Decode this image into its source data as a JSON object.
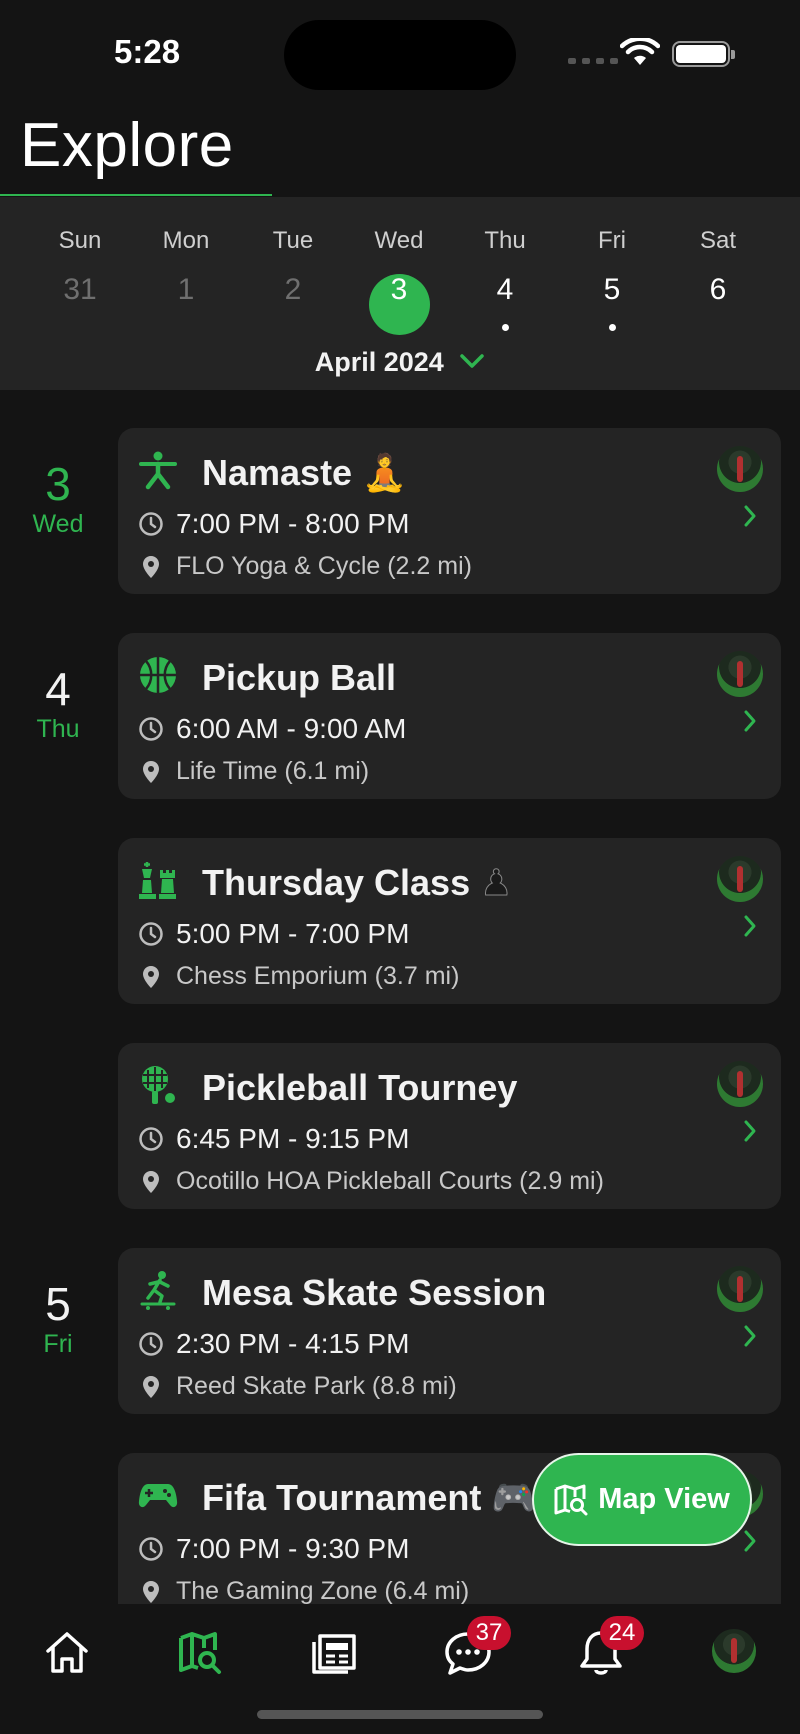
{
  "status": {
    "time": "5:28"
  },
  "header": {
    "title": "Explore"
  },
  "calendar": {
    "weekdays": [
      "Sun",
      "Mon",
      "Tue",
      "Wed",
      "Thu",
      "Fri",
      "Sat"
    ],
    "days": [
      "31",
      "1",
      "2",
      "3",
      "4",
      "5",
      "6"
    ],
    "selected_index": 3,
    "dots_on": [
      "4",
      "5"
    ],
    "month_label": "April 2024"
  },
  "dates": [
    {
      "num": "3",
      "day": "Wed"
    },
    {
      "num": "4",
      "day": "Thu"
    },
    {
      "num": "5",
      "day": "Fri"
    }
  ],
  "events": [
    {
      "title": "Namaste",
      "emoji": "🧘",
      "time": "7:00 PM - 8:00 PM",
      "location": "FLO Yoga & Cycle (2.2 mi)",
      "icon": "yoga-icon"
    },
    {
      "title": "Pickup Ball",
      "emoji": "",
      "time": "6:00 AM - 9:00 AM",
      "location": "Life Time (6.1 mi)",
      "icon": "basketball-icon"
    },
    {
      "title": "Thursday Class",
      "emoji": "♟",
      "time": "5:00 PM - 7:00 PM",
      "location": "Chess Emporium (3.7 mi)",
      "icon": "chess-icon"
    },
    {
      "title": "Pickleball Tourney",
      "emoji": "",
      "time": "6:45 PM - 9:15 PM",
      "location": "Ocotillo HOA Pickleball Courts (2.9 mi)",
      "icon": "pickleball-icon"
    },
    {
      "title": "Mesa Skate Session",
      "emoji": "",
      "time": "2:30 PM - 4:15 PM",
      "location": "Reed Skate Park (8.8 mi)",
      "icon": "skateboard-icon"
    },
    {
      "title": "Fifa Tournament",
      "emoji": "🎮",
      "time": "7:00 PM - 9:30 PM",
      "location": "The Gaming Zone (6.4 mi)",
      "icon": "gamepad-icon"
    }
  ],
  "fab": {
    "label": "Map View"
  },
  "tabbar": {
    "messages_badge": "37",
    "notifications_badge": "24"
  },
  "colors": {
    "accent": "#2fb550",
    "card": "#242424",
    "background": "#141414",
    "badge": "#c8102e"
  }
}
